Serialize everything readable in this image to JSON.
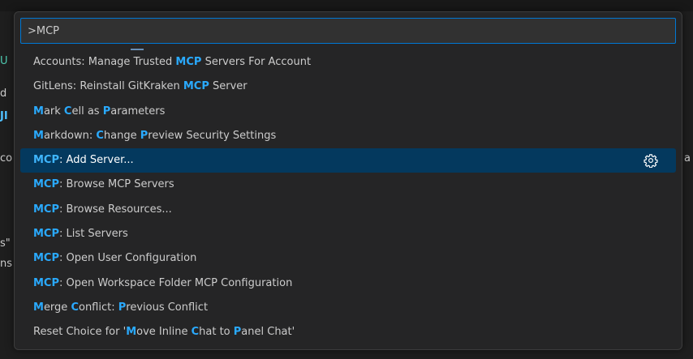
{
  "background": {
    "fragments": [
      "U",
      "d",
      "JI",
      "co",
      "a",
      "s\"",
      "ns"
    ]
  },
  "palette": {
    "input_value": ">MCP",
    "items": [
      {
        "segments": [
          {
            "t": "Accounts: Manage Trusted "
          },
          {
            "t": "MCP",
            "h": true
          },
          {
            "t": " Servers For Account"
          }
        ]
      },
      {
        "segments": [
          {
            "t": "GitLens: Reinstall GitKraken "
          },
          {
            "t": "MCP",
            "h": true
          },
          {
            "t": " Server"
          }
        ]
      },
      {
        "segments": [
          {
            "t": "M",
            "h": true
          },
          {
            "t": "ark "
          },
          {
            "t": "C",
            "h": true
          },
          {
            "t": "ell as "
          },
          {
            "t": "P",
            "h": true
          },
          {
            "t": "arameters"
          }
        ]
      },
      {
        "segments": [
          {
            "t": "M",
            "h": true
          },
          {
            "t": "arkdown: "
          },
          {
            "t": "C",
            "h": true
          },
          {
            "t": "hange "
          },
          {
            "t": "P",
            "h": true
          },
          {
            "t": "review Security Settings"
          }
        ]
      },
      {
        "segments": [
          {
            "t": "MCP",
            "h": true
          },
          {
            "t": ": Add Server..."
          }
        ],
        "selected": true,
        "gear": true
      },
      {
        "segments": [
          {
            "t": "MCP",
            "h": true
          },
          {
            "t": ": Browse MCP Servers"
          }
        ]
      },
      {
        "segments": [
          {
            "t": "MCP",
            "h": true
          },
          {
            "t": ": Browse Resources..."
          }
        ]
      },
      {
        "segments": [
          {
            "t": "MCP",
            "h": true
          },
          {
            "t": ": List Servers"
          }
        ]
      },
      {
        "segments": [
          {
            "t": "MCP",
            "h": true
          },
          {
            "t": ": Open User Configuration"
          }
        ]
      },
      {
        "segments": [
          {
            "t": "MCP",
            "h": true
          },
          {
            "t": ": Open Workspace Folder MCP Configuration"
          }
        ]
      },
      {
        "segments": [
          {
            "t": "M",
            "h": true
          },
          {
            "t": "erge "
          },
          {
            "t": "C",
            "h": true
          },
          {
            "t": "onflict: "
          },
          {
            "t": "P",
            "h": true
          },
          {
            "t": "revious Conflict"
          }
        ]
      },
      {
        "segments": [
          {
            "t": "Reset Choice for '"
          },
          {
            "t": "M",
            "h": true
          },
          {
            "t": "ove Inline "
          },
          {
            "t": "C",
            "h": true
          },
          {
            "t": "hat to "
          },
          {
            "t": "P",
            "h": true
          },
          {
            "t": "anel Chat'"
          }
        ]
      }
    ]
  },
  "colors": {
    "accent": "#0078d4",
    "highlight": "#2aaaff",
    "selected_bg": "#04395e"
  },
  "icons": {
    "configure": "gear-icon"
  }
}
